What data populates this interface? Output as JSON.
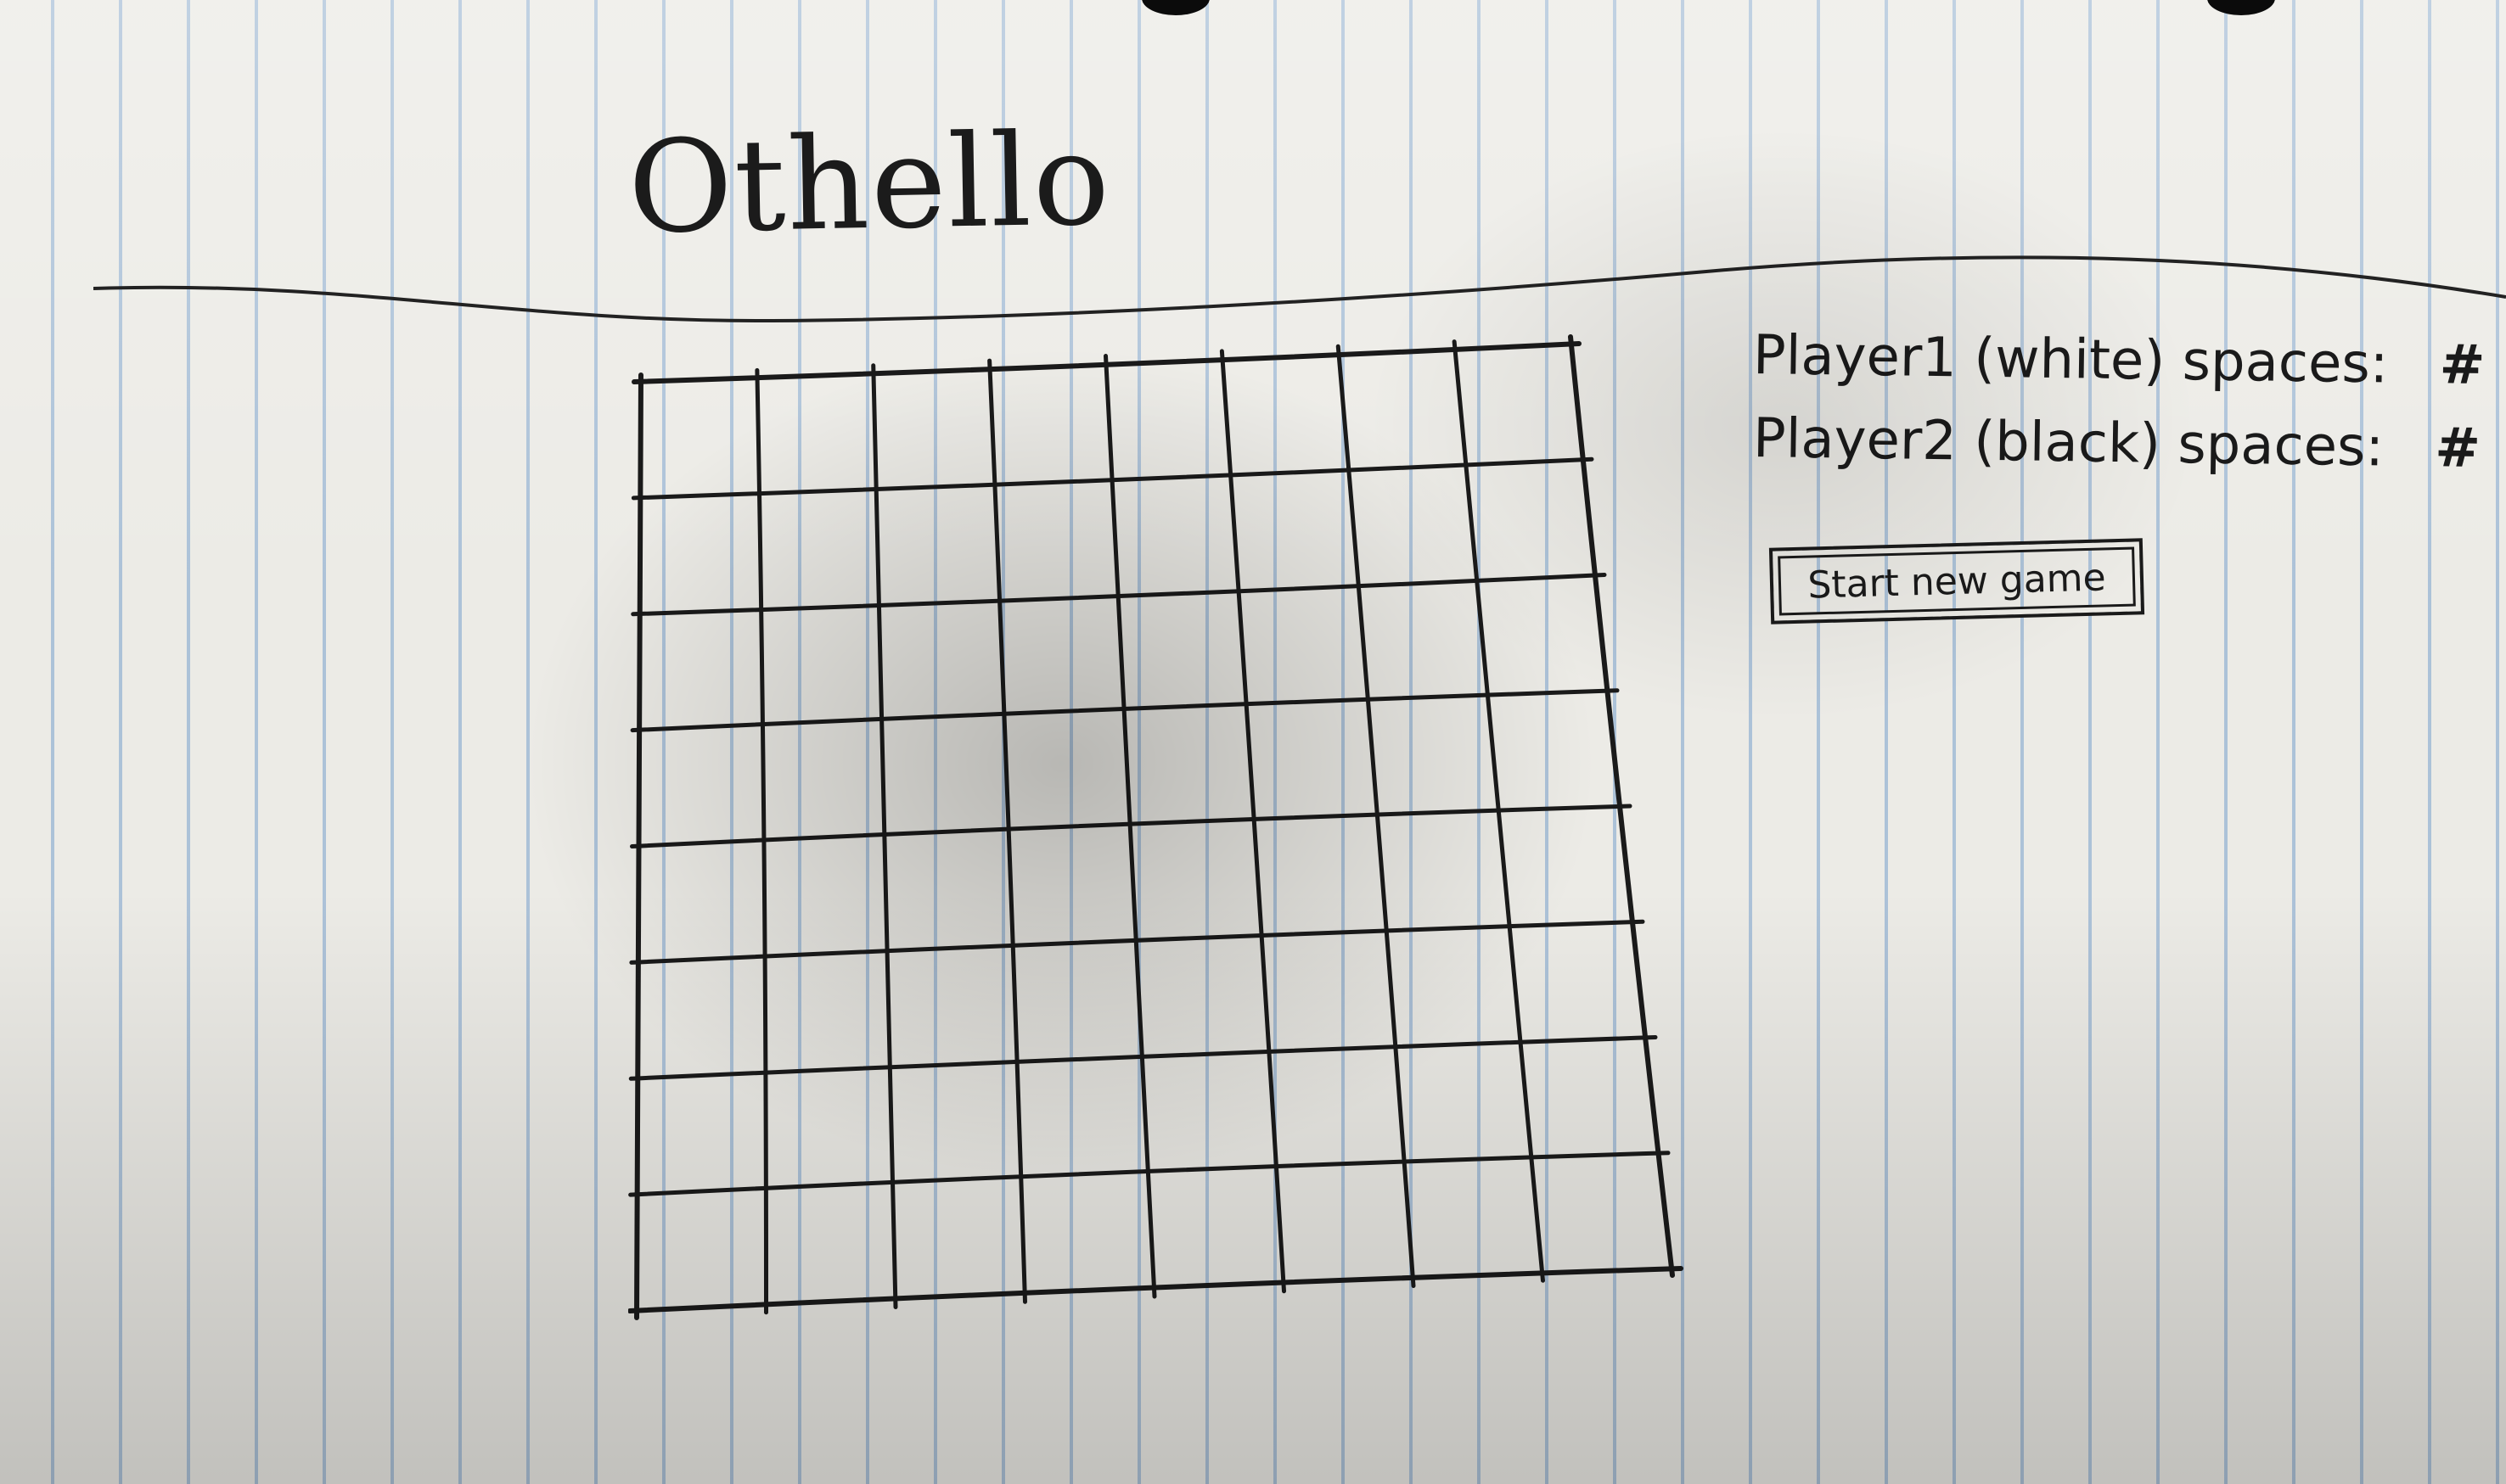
{
  "app": {
    "title": "Othello"
  },
  "scoreboard": {
    "player1_label": "Player1 (white) spaces:",
    "player1_count": "#",
    "player2_label": "Player2 (black) spaces:",
    "player2_count": "#"
  },
  "actions": {
    "new_game_label": "Start new game"
  },
  "board": {
    "rows": 8,
    "cols": 8
  },
  "colors": {
    "ink": "#1a1a1a",
    "paper": "#ecebe6",
    "rule_line": "#78a0cd"
  }
}
